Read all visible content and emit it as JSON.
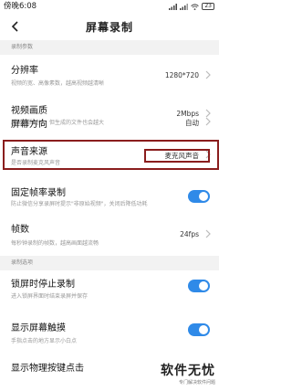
{
  "status": {
    "time": "傍晚6:08",
    "battery": "23"
  },
  "header": {
    "title": "屏幕录制"
  },
  "sections": {
    "params": "录制参数",
    "options": "录制选项"
  },
  "settings": {
    "resolution": {
      "title": "分辨率",
      "desc": "视频的宽、高像素数，越高视频越清晰",
      "value": "1280*720"
    },
    "quality": {
      "title": "视频画质",
      "desc": "越高画质越好，但生成的文件也会越大",
      "value": "2Mbps"
    },
    "orientation": {
      "title": "屏幕方向",
      "desc": "",
      "value": "自动"
    },
    "audio": {
      "title": "声音来源",
      "desc": "是否录制麦克风声音",
      "value": "麦克风声音"
    },
    "fixed_rate": {
      "title": "固定帧率录制",
      "desc": "防止微信分享录屏时提示\"非原始视频\"，关闭后降低功耗"
    },
    "fps": {
      "title": "帧数",
      "desc": "每秒钟录制的帧数，越高画面越流畅",
      "value": "24fps"
    },
    "lock_stop": {
      "title": "锁屏时停止录制",
      "desc": "进入锁屏界面时结束录屏并保存"
    },
    "show_touch": {
      "title": "显示屏幕触摸",
      "desc": "手指点击的地方显示小白点"
    },
    "show_nav": {
      "title": "显示物理按键点击"
    }
  },
  "watermark": {
    "logo": "软件无忧",
    "sub": "专门解决软件问题"
  }
}
